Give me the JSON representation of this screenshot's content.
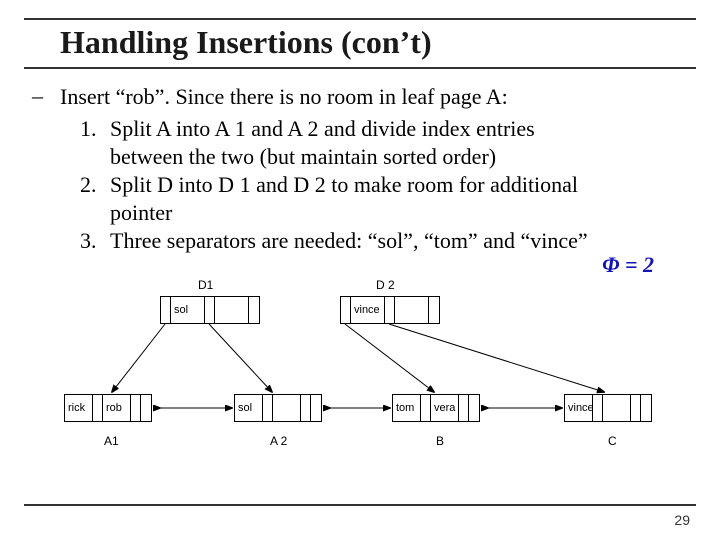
{
  "title": "Handling Insertions (con’t)",
  "bullet_lead": "Insert “rob”. Since there is no room in leaf page A:",
  "steps": [
    {
      "num": "1.",
      "text1": "Split A into A 1 and A 2 and divide index entries",
      "text2": "between the two (but maintain sorted order)"
    },
    {
      "num": "2.",
      "text1": "Split D into D 1 and D 2 to make room for additional",
      "text2": "pointer"
    },
    {
      "num": "3.",
      "text1": "Three separators are needed: “sol”, “tom” and “vince”",
      "text2": ""
    }
  ],
  "phi": "Φ = 2",
  "diagram": {
    "labels": {
      "D1": "D1",
      "D2": "D 2",
      "A1": "A1",
      "A2": "A 2",
      "B": "B",
      "C": "C"
    },
    "d1": {
      "k1": "sol"
    },
    "d2": {
      "k1": "vince"
    },
    "a1": {
      "k1": "rick",
      "k2": "rob"
    },
    "a2": {
      "k1": "sol"
    },
    "b": {
      "k1": "tom",
      "k2": "vera"
    },
    "c": {
      "k1": "vince"
    }
  },
  "page_number": "29"
}
